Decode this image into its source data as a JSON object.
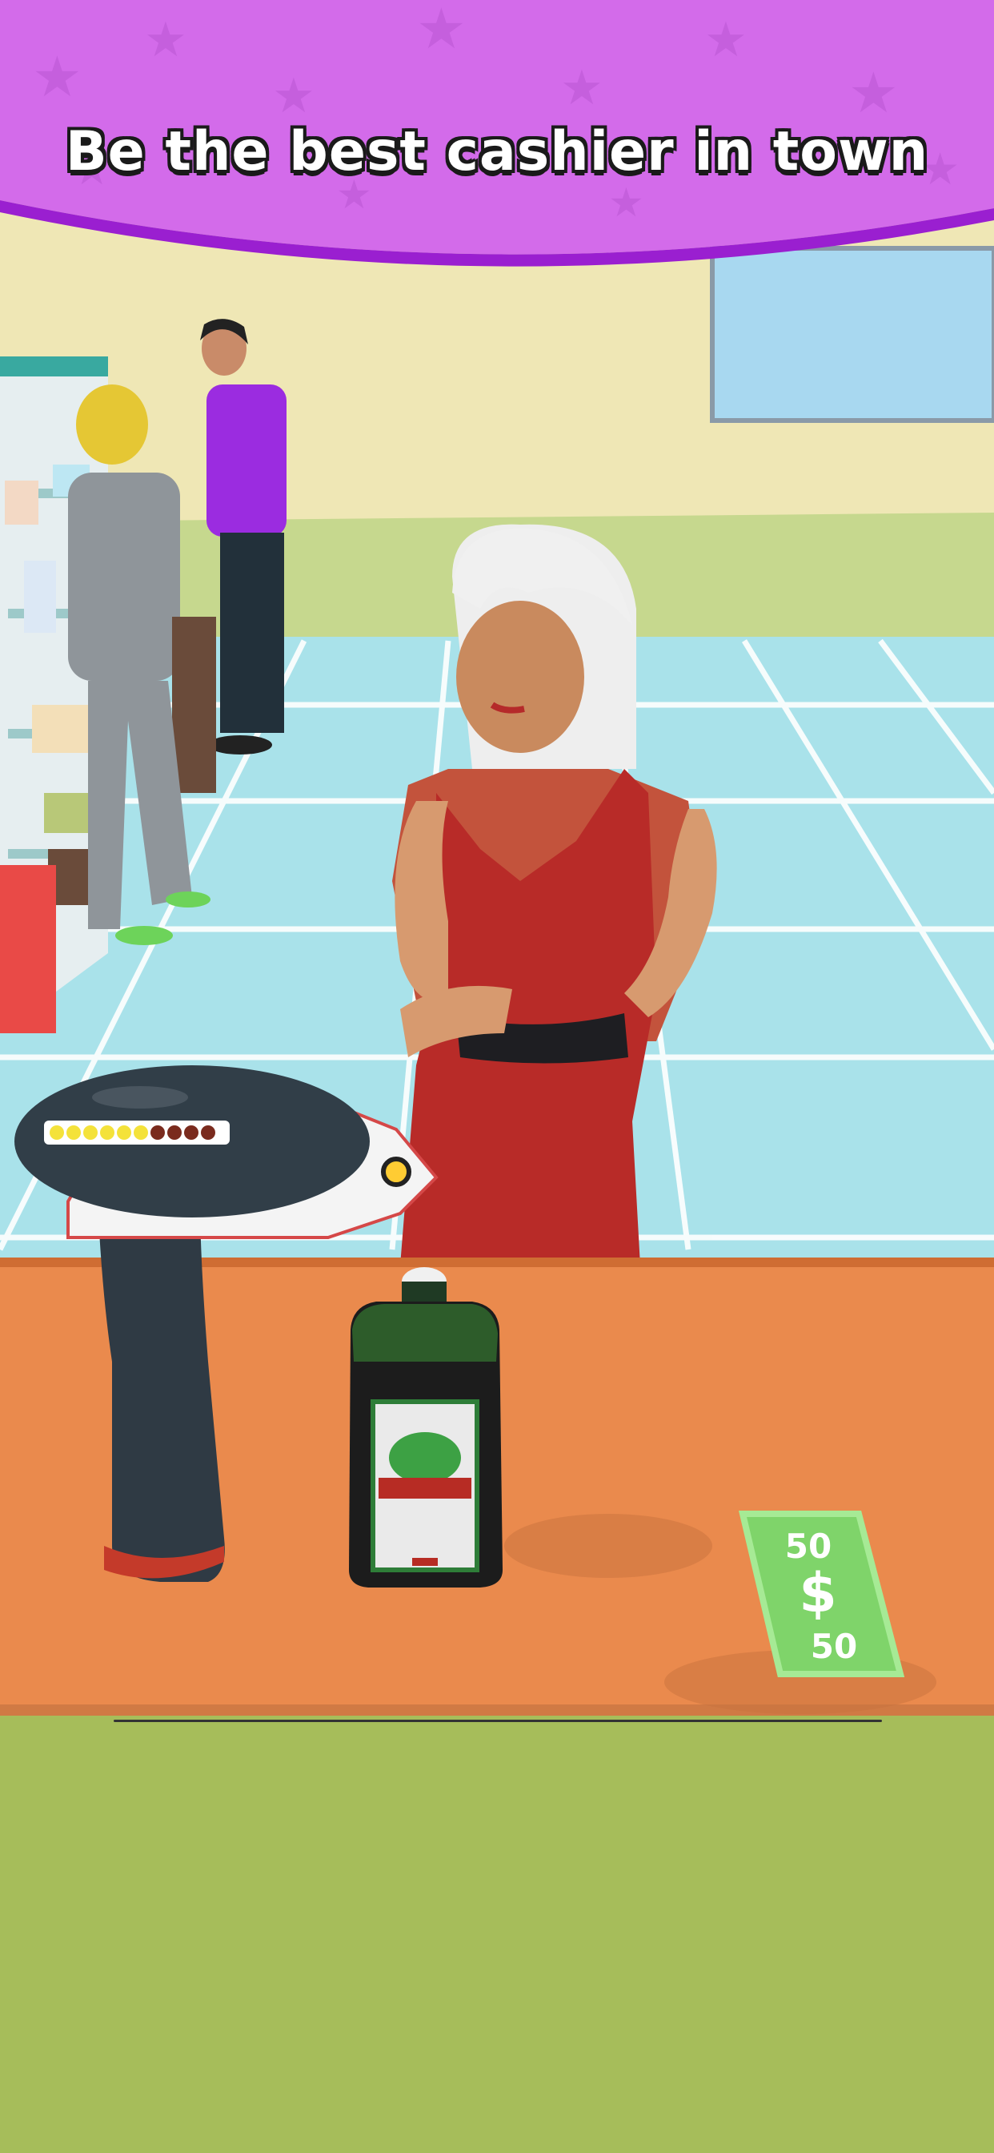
{
  "banner": {
    "headline": "Be the best cashier in town",
    "color": "#d36bea",
    "edge_color": "#9a1fd0"
  },
  "scanner": {
    "charge_level": 0.6,
    "charge_segments_total": 10,
    "charge_segments_filled": 6,
    "active_color": "#f4e23a",
    "inactive_color": "#7a2b1e"
  },
  "bill": {
    "top_value": "50",
    "symbol": "$",
    "bottom_value": "50",
    "color": "#7fd46a"
  },
  "product": {
    "icon": "liquor-bottle-icon"
  },
  "customer": {
    "icon": "woman-red-dress-customer"
  },
  "colors": {
    "counter": "#ea8a4d",
    "floor": "#a9e2ea",
    "wall": "#efe7b5",
    "grass": "#a6bd5a"
  }
}
